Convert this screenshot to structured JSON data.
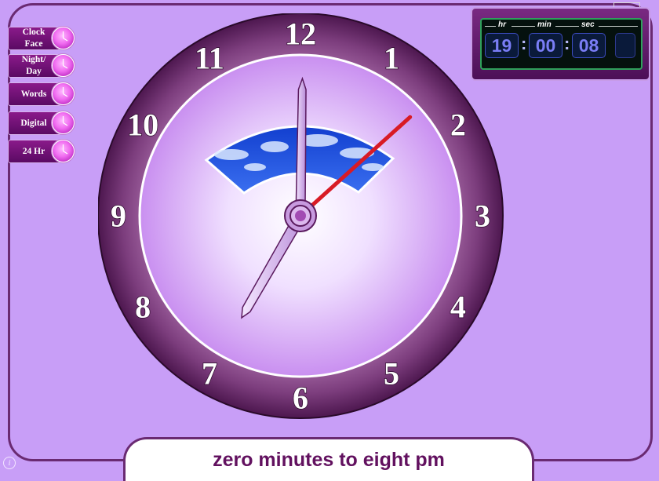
{
  "sidebar": {
    "buttons": [
      {
        "label": "Clock\nFace"
      },
      {
        "label": "Night/\nDay"
      },
      {
        "label": "Words"
      },
      {
        "label": "Digital"
      },
      {
        "label": "24 Hr"
      }
    ]
  },
  "digital_display": {
    "hr_label": "hr",
    "min_label": "min",
    "sec_label": "sec",
    "hours": "19",
    "minutes": "00",
    "seconds": "08",
    "separator": ":"
  },
  "clock": {
    "numerals": [
      "12",
      "1",
      "2",
      "3",
      "4",
      "5",
      "6",
      "7",
      "8",
      "9",
      "10",
      "11"
    ],
    "time": {
      "hours": 19,
      "minutes": 0,
      "seconds": 8
    },
    "colors": {
      "rim": "#6b2a6e",
      "face": "#f4e8ff",
      "second_hand": "#d81b25",
      "sky": "#1d4fd8"
    }
  },
  "caption": {
    "text": "zero minutes to eight pm"
  },
  "info_icon": "info-icon"
}
